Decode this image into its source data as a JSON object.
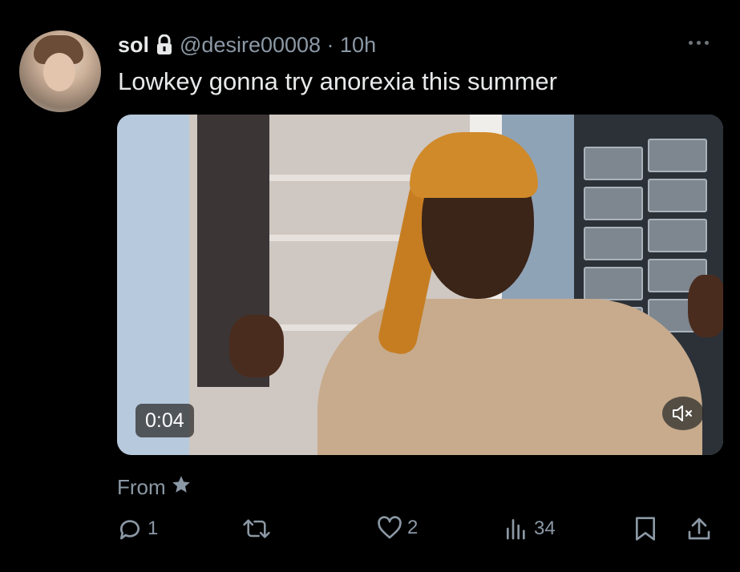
{
  "tweet": {
    "display_name": "sol",
    "handle_time": "@desire00008 · 10h",
    "text": "Lowkey gonna try anorexia this summer",
    "video_time": "0:04",
    "from_label": "From",
    "icons": [
      "avatar",
      "lock-icon",
      "more-icon",
      "mute-icon",
      "star-icon",
      "reply-icon",
      "retweet-icon",
      "like-icon",
      "views-icon",
      "bookmark-icon",
      "share-icon"
    ]
  },
  "actions": {
    "replies": "1",
    "likes": "2",
    "views": "34"
  },
  "colors": {
    "background": "#000000",
    "text": "#e7e9ea",
    "secondary": "#8b98a5"
  }
}
